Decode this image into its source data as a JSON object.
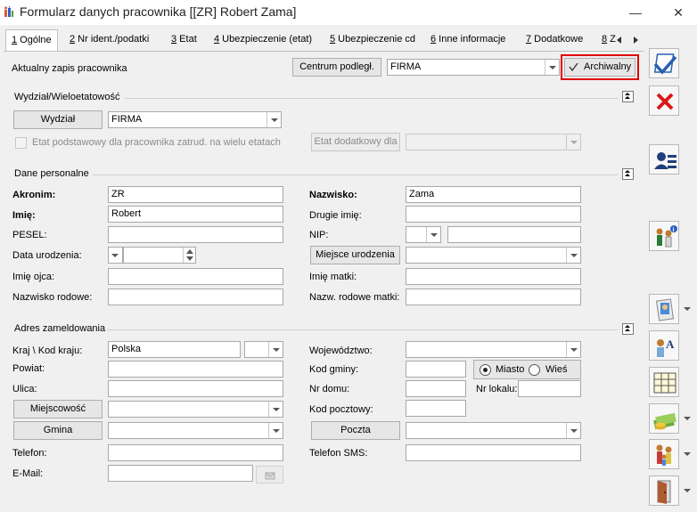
{
  "window": {
    "title": "Formularz danych pracownika [[ZR] Robert Zama]",
    "minimize": "—",
    "close": "✕"
  },
  "tabs": [
    {
      "key": "1",
      "label": " Ogólne"
    },
    {
      "key": "2",
      "label": " Nr ident./podatki"
    },
    {
      "key": "3",
      "label": " Etat"
    },
    {
      "key": "4",
      "label": " Ubezpieczenie (etat)"
    },
    {
      "key": "5",
      "label": " Ubezpieczenie cd"
    },
    {
      "key": "6",
      "label": " Inne informacje"
    },
    {
      "key": "7",
      "label": " Dodatkowe"
    },
    {
      "key": "8",
      "label": " Z"
    }
  ],
  "top": {
    "aktualny_label": "Aktualny zapis pracownika",
    "centrum_button": "Centrum podległ.",
    "centrum_value": "FIRMA",
    "archiwalny_label": "Archiwalny",
    "archiwalny_checked": true,
    "highlight_color": "#e00000"
  },
  "wydzial": {
    "section_title": "Wydział/Wieloetatowość",
    "wydzial_button": "Wydział",
    "wydzial_value": "FIRMA",
    "etat_checkbox_label": "Etat podstawowy dla pracownika zatrud. na wielu etatach",
    "etat_dodatkowy_button": "Etat dodatkowy dla",
    "etat_dodatkowy_value": ""
  },
  "dane": {
    "section_title": "Dane personalne",
    "akronim_label": "Akronim:",
    "akronim_value": "ZR",
    "nazwisko_label": "Nazwisko:",
    "nazwisko_value": "Zama",
    "imie_label": "Imię:",
    "imie_value": "Robert",
    "drugie_imie_label": "Drugie imię:",
    "drugie_imie_value": "",
    "pesel_label": "PESEL:",
    "pesel_value": "",
    "nip_label": "NIP:",
    "nip_prefix": "",
    "nip_value": "",
    "data_urodzenia_label": "Data urodzenia:",
    "data_urodzenia_value": "",
    "miejsce_urodzenia_button": "Miejsce urodzenia",
    "miejsce_urodzenia_value": "",
    "imie_ojca_label": "Imię ojca:",
    "imie_ojca_value": "",
    "imie_matki_label": "Imię matki:",
    "imie_matki_value": "",
    "nazwisko_rodowe_label": "Nazwisko rodowe:",
    "nazwisko_rodowe_value": "",
    "nazw_rodowe_matki_label": "Nazw. rodowe matki:",
    "nazw_rodowe_matki_value": ""
  },
  "adres": {
    "section_title": "Adres zameldowania",
    "kraj_label": "Kraj \\ Kod kraju:",
    "kraj_value": "Polska",
    "kod_kraju_value": "",
    "wojewodztwo_label": "Województwo:",
    "wojewodztwo_value": "",
    "powiat_label": "Powiat:",
    "powiat_value": "",
    "kod_gminy_label": "Kod gminy:",
    "kod_gminy_value": "",
    "miasto_label": "Miasto",
    "wies_label": "Wieś",
    "miasto_selected": true,
    "ulica_label": "Ulica:",
    "ulica_value": "",
    "nr_domu_label": "Nr domu:",
    "nr_domu_value": "",
    "nr_lokalu_label": "Nr lokalu:",
    "nr_lokalu_value": "",
    "miejscowosc_button": "Miejscowość",
    "miejscowosc_value": "",
    "kod_pocztowy_label": "Kod pocztowy:",
    "kod_pocztowy_value": "",
    "gmina_button": "Gmina",
    "gmina_value": "",
    "poczta_button": "Poczta",
    "poczta_value": "",
    "telefon_label": "Telefon:",
    "telefon_value": "",
    "telefon_sms_label": "Telefon SMS:",
    "telefon_sms_value": "",
    "email_label": "E-Mail:",
    "email_value": ""
  },
  "toolbar": {
    "save_icon": "save-icon",
    "cancel_icon": "cancel-icon",
    "employee_card_icon": "employee-card-icon",
    "people_info_icon": "people-info-icon",
    "photo_icon": "photo-icon",
    "person_text_icon": "person-text-icon",
    "table_icon": "table-icon",
    "money_icon": "money-icon",
    "family_icon": "family-icon",
    "door_icon": "door-icon"
  }
}
